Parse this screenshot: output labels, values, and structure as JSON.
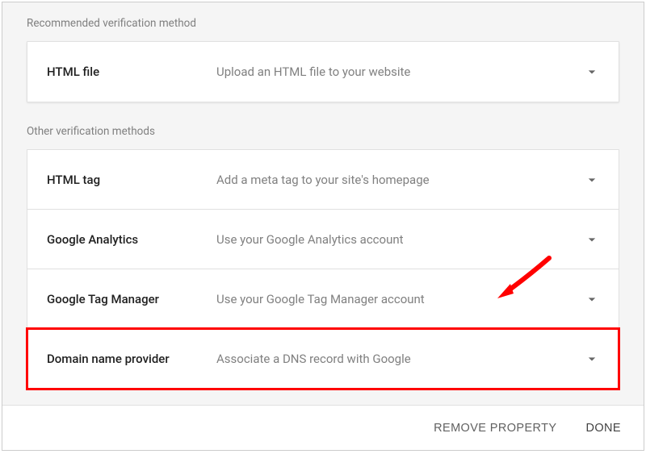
{
  "sections": {
    "recommended_label": "Recommended verification method",
    "other_label": "Other verification methods"
  },
  "recommended": [
    {
      "title": "HTML file",
      "desc": "Upload an HTML file to your website"
    }
  ],
  "other": [
    {
      "title": "HTML tag",
      "desc": "Add a meta tag to your site's homepage"
    },
    {
      "title": "Google Analytics",
      "desc": "Use your Google Analytics account"
    },
    {
      "title": "Google Tag Manager",
      "desc": "Use your Google Tag Manager account"
    },
    {
      "title": "Domain name provider",
      "desc": "Associate a DNS record with Google"
    }
  ],
  "footer": {
    "remove": "REMOVE PROPERTY",
    "done": "DONE"
  }
}
